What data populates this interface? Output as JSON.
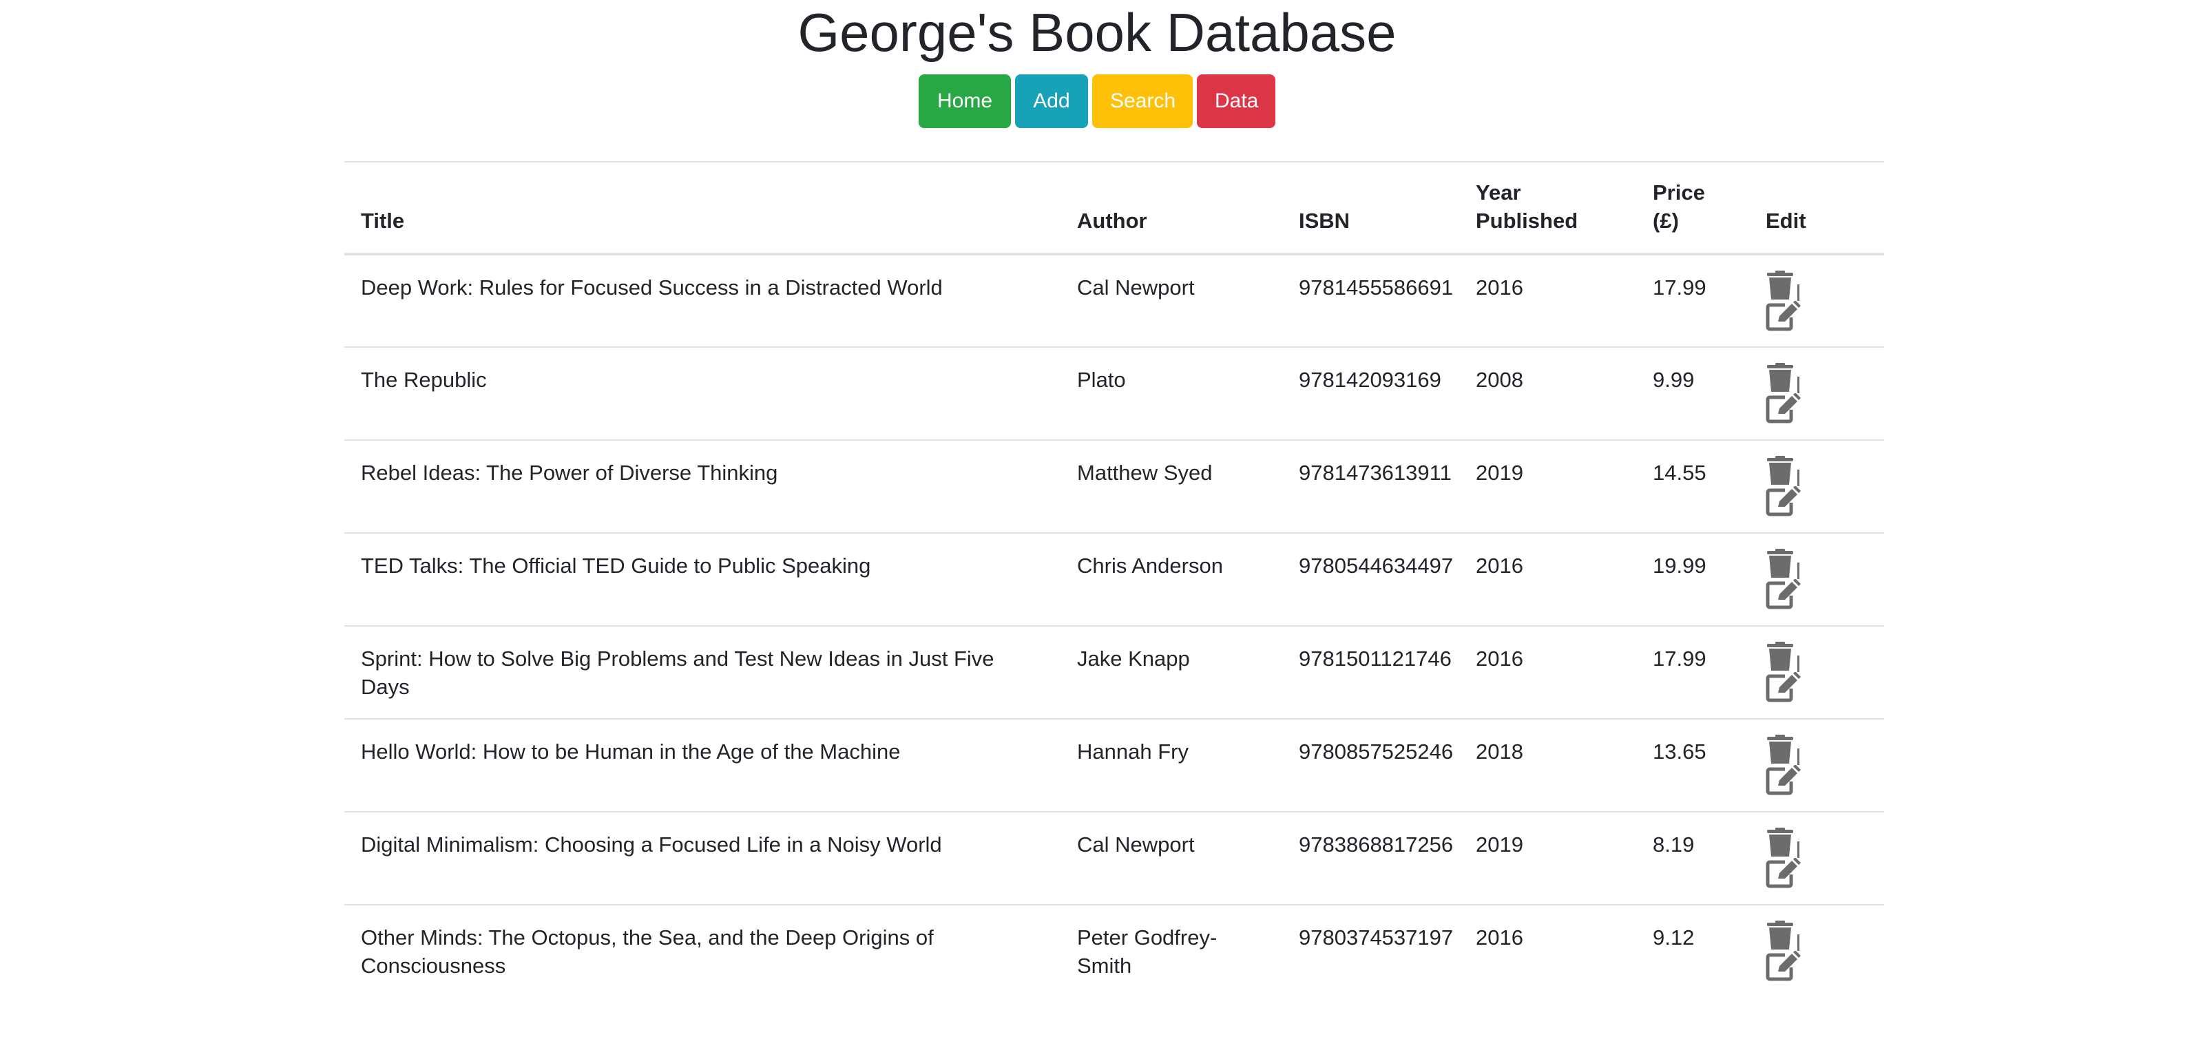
{
  "page": {
    "title": "George's Book Database"
  },
  "nav": {
    "home": "Home",
    "add": "Add",
    "search": "Search",
    "data": "Data"
  },
  "colors": {
    "home": "#28a745",
    "add": "#17a2b8",
    "search": "#ffc107",
    "data": "#dc3545",
    "icon": "#6c6c6c"
  },
  "table": {
    "headers": {
      "title": "Title",
      "author": "Author",
      "isbn": "ISBN",
      "year": "Year Published",
      "price": "Price (£)",
      "edit": "Edit"
    },
    "row_icons": [
      "trash-icon",
      "edit-icon"
    ],
    "rows": [
      {
        "title": "Deep Work: Rules for Focused Success in a Distracted World",
        "author": "Cal Newport",
        "isbn": "9781455586691",
        "year": "2016",
        "price": "17.99"
      },
      {
        "title": "The Republic",
        "author": "Plato",
        "isbn": "978142093169",
        "year": "2008",
        "price": "9.99"
      },
      {
        "title": "Rebel Ideas: The Power of Diverse Thinking",
        "author": "Matthew Syed",
        "isbn": "9781473613911",
        "year": "2019",
        "price": "14.55"
      },
      {
        "title": "TED Talks: The Official TED Guide to Public Speaking",
        "author": "Chris Anderson",
        "isbn": "9780544634497",
        "year": "2016",
        "price": "19.99"
      },
      {
        "title": "Sprint: How to Solve Big Problems and Test New Ideas in Just Five Days",
        "author": "Jake Knapp",
        "isbn": "9781501121746",
        "year": "2016",
        "price": "17.99"
      },
      {
        "title": "Hello World: How to be Human in the Age of the Machine",
        "author": "Hannah Fry",
        "isbn": "9780857525246",
        "year": "2018",
        "price": "13.65"
      },
      {
        "title": "Digital Minimalism: Choosing a Focused Life in a Noisy World",
        "author": "Cal Newport",
        "isbn": "9783868817256",
        "year": "2019",
        "price": "8.19"
      },
      {
        "title": "Other Minds: The Octopus, the Sea, and the Deep Origins of Consciousness",
        "author": "Peter Godfrey-Smith",
        "isbn": "9780374537197",
        "year": "2016",
        "price": "9.12"
      }
    ]
  }
}
